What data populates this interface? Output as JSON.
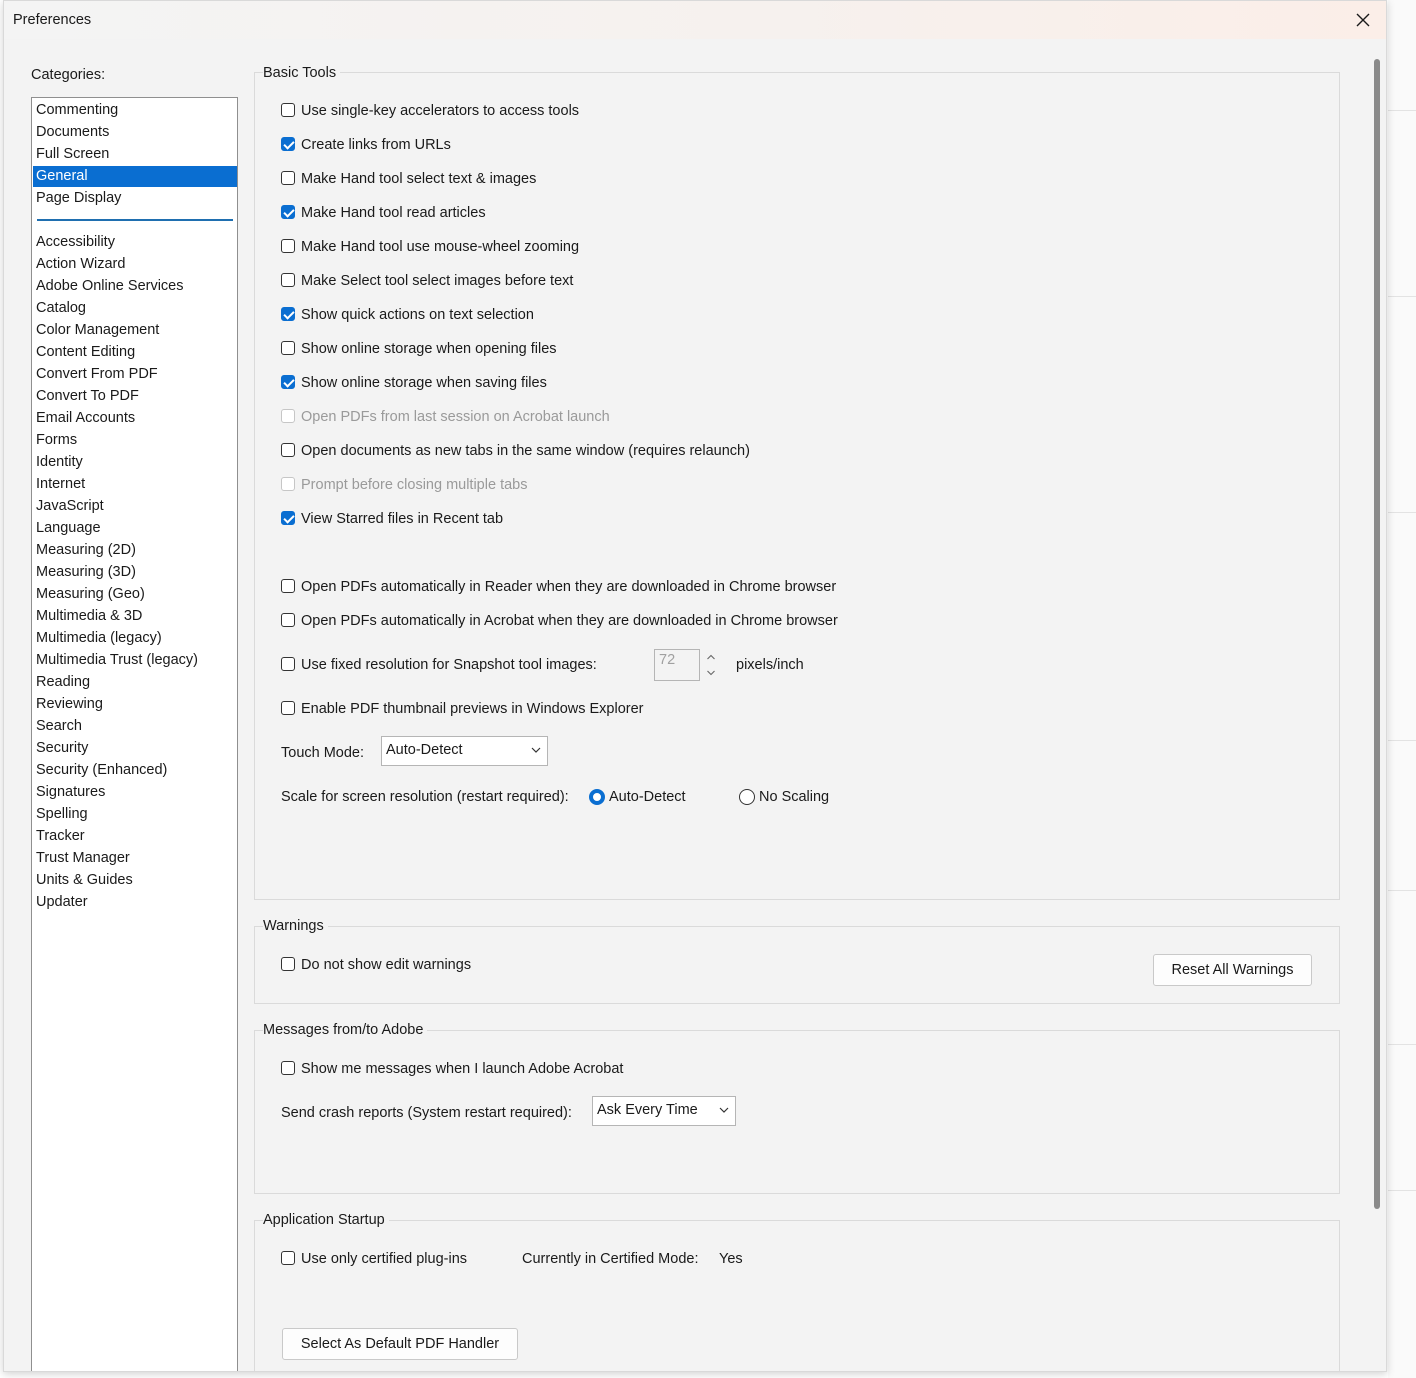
{
  "window": {
    "title": "Preferences"
  },
  "categories": {
    "label": "Categories:",
    "top_items": [
      {
        "label": "Commenting",
        "selected": false
      },
      {
        "label": "Documents",
        "selected": false
      },
      {
        "label": "Full Screen",
        "selected": false
      },
      {
        "label": "General",
        "selected": true
      },
      {
        "label": "Page Display",
        "selected": false
      }
    ],
    "items": [
      "Accessibility",
      "Action Wizard",
      "Adobe Online Services",
      "Catalog",
      "Color Management",
      "Content Editing",
      "Convert From PDF",
      "Convert To PDF",
      "Email Accounts",
      "Forms",
      "Identity",
      "Internet",
      "JavaScript",
      "Language",
      "Measuring (2D)",
      "Measuring (3D)",
      "Measuring (Geo)",
      "Multimedia & 3D",
      "Multimedia (legacy)",
      "Multimedia Trust (legacy)",
      "Reading",
      "Reviewing",
      "Search",
      "Security",
      "Security (Enhanced)",
      "Signatures",
      "Spelling",
      "Tracker",
      "Trust Manager",
      "Units & Guides",
      "Updater"
    ]
  },
  "basic_tools": {
    "title": "Basic Tools",
    "options": [
      {
        "label": "Use single-key accelerators to access tools",
        "checked": false,
        "enabled": true
      },
      {
        "label": "Create links from URLs",
        "checked": true,
        "enabled": true
      },
      {
        "label": "Make Hand tool select text & images",
        "checked": false,
        "enabled": true
      },
      {
        "label": "Make Hand tool read articles",
        "checked": true,
        "enabled": true
      },
      {
        "label": "Make Hand tool use mouse-wheel zooming",
        "checked": false,
        "enabled": true
      },
      {
        "label": "Make Select tool select images before text",
        "checked": false,
        "enabled": true
      },
      {
        "label": "Show quick actions on text selection",
        "checked": true,
        "enabled": true
      },
      {
        "label": "Show online storage when opening files",
        "checked": false,
        "enabled": true
      },
      {
        "label": "Show online storage when saving files",
        "checked": true,
        "enabled": true
      },
      {
        "label": "Open PDFs from last session on Acrobat launch",
        "checked": false,
        "enabled": false
      },
      {
        "label": "Open documents as new tabs in the same window (requires relaunch)",
        "checked": false,
        "enabled": true
      },
      {
        "label": "Prompt before closing multiple tabs",
        "checked": false,
        "enabled": false
      },
      {
        "label": "View Starred files in Recent tab",
        "checked": true,
        "enabled": true
      }
    ],
    "chrome_options": [
      {
        "label": "Open PDFs automatically in Reader when they are downloaded in Chrome browser",
        "checked": false
      },
      {
        "label": "Open PDFs automatically in Acrobat when they are downloaded in Chrome browser",
        "checked": false
      }
    ],
    "snapshot": {
      "label": "Use fixed resolution for Snapshot tool images:",
      "checked": false,
      "value": "72",
      "unit": "pixels/inch"
    },
    "thumbnail": {
      "label": "Enable PDF thumbnail previews in Windows Explorer",
      "checked": false
    },
    "touch_mode": {
      "label": "Touch Mode:",
      "value": "Auto-Detect"
    },
    "scale": {
      "label": "Scale for screen resolution (restart required):",
      "option_auto": "Auto-Detect",
      "option_none": "No Scaling",
      "selected": "Auto-Detect"
    }
  },
  "warnings": {
    "title": "Warnings",
    "no_edit_warnings": {
      "label": "Do not show edit warnings",
      "checked": false
    },
    "reset_button": "Reset All Warnings"
  },
  "messages": {
    "title": "Messages from/to Adobe",
    "show_messages": {
      "label": "Show me messages when I launch Adobe Acrobat",
      "checked": false
    },
    "crash_label": "Send crash reports (System restart required):",
    "crash_value": "Ask Every Time"
  },
  "startup": {
    "title": "Application Startup",
    "certified": {
      "label": "Use only certified plug-ins",
      "checked": false
    },
    "mode_label": "Currently in Certified Mode:",
    "mode_value": "Yes",
    "default_handler_button": "Select As Default PDF Handler"
  },
  "colors": {
    "accent": "#0a6ed1",
    "window_bg": "#f3f3f3"
  }
}
